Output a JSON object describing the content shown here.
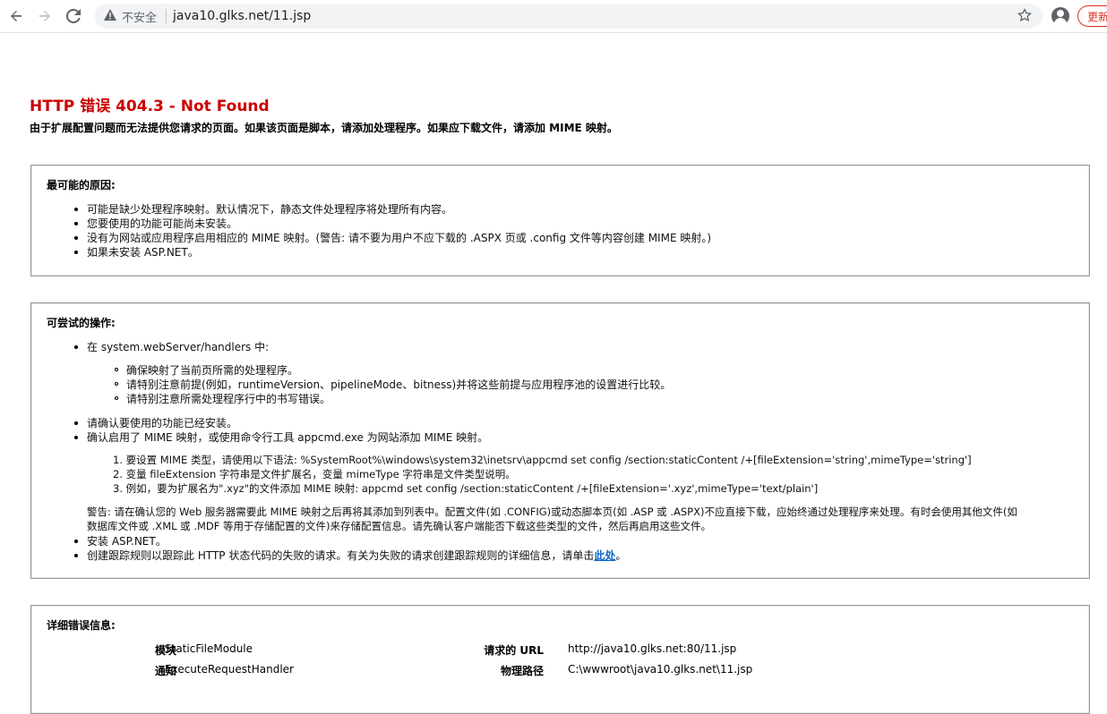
{
  "browser": {
    "security_label": "不安全",
    "url": "java10.glks.net/11.jsp",
    "update_label": "更新"
  },
  "page": {
    "error_title": "HTTP 错误 404.3 - Not Found",
    "error_description": "由于扩展配置问题而无法提供您请求的页面。如果该页面是脚本，请添加处理程序。如果应下载文件，请添加 MIME 映射。"
  },
  "causes": {
    "heading": "最可能的原因:",
    "items": [
      "可能是缺少处理程序映射。默认情况下，静态文件处理程序将处理所有内容。",
      "您要使用的功能可能尚未安装。",
      "没有为网站或应用程序启用相应的 MIME 映射。(警告: 请不要为用户不应下载的 .ASPX 页或 .config 文件等内容创建 MIME 映射。)",
      "如果未安装 ASP.NET。"
    ]
  },
  "actions": {
    "heading": "可尝试的操作:",
    "item1": "在 system.webServer/handlers 中:",
    "sub_items": [
      "确保映射了当前页所需的处理程序。",
      "请特别注意前提(例如，runtimeVersion、pipelineMode、bitness)并将这些前提与应用程序池的设置进行比较。",
      "请特别注意所需处理程序行中的书写错误。"
    ],
    "item2": "请确认要使用的功能已经安装。",
    "item3": "确认启用了 MIME 映射，或使用命令行工具 appcmd.exe 为网站添加 MIME 映射。",
    "steps": [
      "1. 要设置 MIME 类型，请使用以下语法: %SystemRoot%\\windows\\system32\\inetsrv\\appcmd set config /section:staticContent /+[fileExtension='string',mimeType='string']",
      "2. 变量 fileExtension 字符串是文件扩展名，变量 mimeType 字符串是文件类型说明。",
      "3. 例如，要为扩展名为\".xyz\"的文件添加 MIME 映射: appcmd set config /section:staticContent /+[fileExtension='.xyz',mimeType='text/plain']"
    ],
    "warning_line1": "警告: 请在确认您的 Web 服务器需要此 MIME 映射之后再将其添加到列表中。配置文件(如 .CONFIG)或动态脚本页(如 .ASP 或 .ASPX)不应直接下载，应始终通过处理程序来处理。有时会使用其他文件(如",
    "warning_line2": "数据库文件或 .XML 或 .MDF 等用于存储配置的文件)来存储配置信息。请先确认客户端能否下载这些类型的文件，然后再启用这些文件。",
    "item4": "安装 ASP.NET。",
    "item5_prefix": "创建跟踪规则以跟踪此 HTTP 状态代码的失败的请求。有关为失败的请求创建跟踪规则的详细信息，请单击",
    "item5_link": "此处",
    "item5_suffix": "。"
  },
  "details": {
    "heading": "详细错误信息:",
    "module_label": "模块",
    "module_value": "StaticFileModule",
    "notification_label": "通知",
    "notification_value": "ExecuteRequestHandler",
    "request_url_label": "请求的 URL",
    "request_url_value": "http://java10.glks.net:80/11.jsp",
    "physical_path_label": "物理路径",
    "physical_path_value": "C:\\wwwroot\\java10.glks.net\\11.jsp"
  }
}
